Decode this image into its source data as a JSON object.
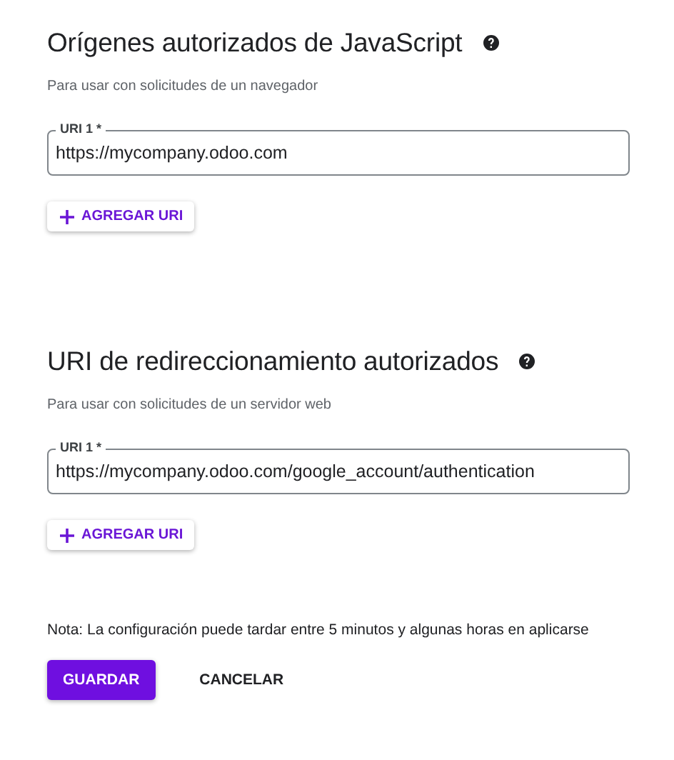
{
  "sections": [
    {
      "title": "Orígenes autorizados de JavaScript",
      "subtitle": "Para usar con solicitudes de un navegador",
      "fields": [
        {
          "label": "URI 1 *",
          "value": "https://mycompany.odoo.com"
        }
      ],
      "add_button": "AGREGAR URI"
    },
    {
      "title": "URI de redireccionamiento autorizados",
      "subtitle": "Para usar con solicitudes de un servidor web",
      "fields": [
        {
          "label": "URI 1 *",
          "value": "https://mycompany.odoo.com/google_account/authentication"
        }
      ],
      "add_button": "AGREGAR URI"
    }
  ],
  "note": "Nota: La configuración puede tardar entre 5 minutos y algunas horas en aplicarse",
  "buttons": [
    {
      "label": "GUARDAR",
      "kind": "primary"
    },
    {
      "label": "CANCELAR",
      "kind": "text"
    }
  ]
}
